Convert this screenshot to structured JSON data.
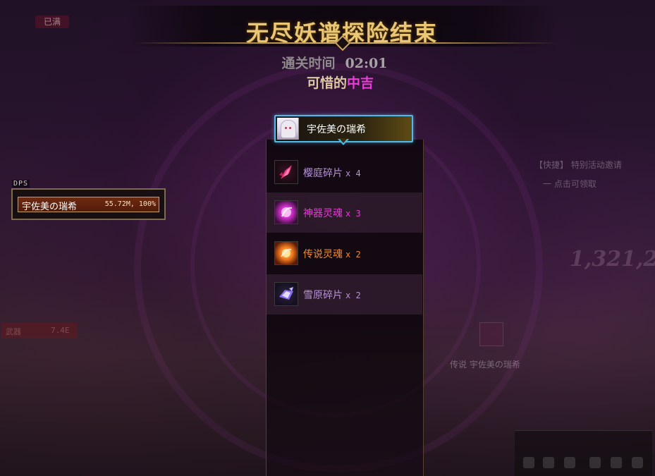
{
  "result_screen": {
    "title": "无尽妖谱探险结束",
    "clear_time_label": "通关时间",
    "clear_time_value": "02:01",
    "rating_prefix": "可惜的",
    "rating_grade": "中吉"
  },
  "player_tab": {
    "name": "宇佐美の瑞希",
    "avatar_icon": "character-portrait-icon",
    "border_color": "#4fb9e8"
  },
  "rewards": [
    {
      "name": "樱庭碎片",
      "qty": "x 4",
      "color": "#b793d6",
      "icon": "sakura-fragment-icon"
    },
    {
      "name": "神器灵魂",
      "qty": "x 3",
      "color": "#e63ad7",
      "icon": "artifact-soul-icon"
    },
    {
      "name": "传说灵魂",
      "qty": "x 2",
      "color": "#f08a2c",
      "icon": "legendary-soul-icon"
    },
    {
      "name": "雪原碎片",
      "qty": "x 2",
      "color": "#b793d6",
      "icon": "snowfield-fragment-icon"
    }
  ],
  "dps": {
    "label": "DPS",
    "player_name": "宇佐美の瑞希",
    "value": "55.72M, 100%"
  },
  "background_hud": {
    "top_left_badge": "已满",
    "right_notice_1": "【快捷】 特别活动邀请",
    "right_notice_2": "一 点击可领取",
    "right_score": "1,321,2",
    "drop_label": "传说 宇佐美の瑞希",
    "left_weapon_label": "武器",
    "left_weapon_value": "7.4E"
  },
  "colors": {
    "title_gold": "#e9c775",
    "grade_magenta": "#e93dd7",
    "epic_purple": "#b793d6",
    "legendary_orange": "#f08a2c"
  }
}
